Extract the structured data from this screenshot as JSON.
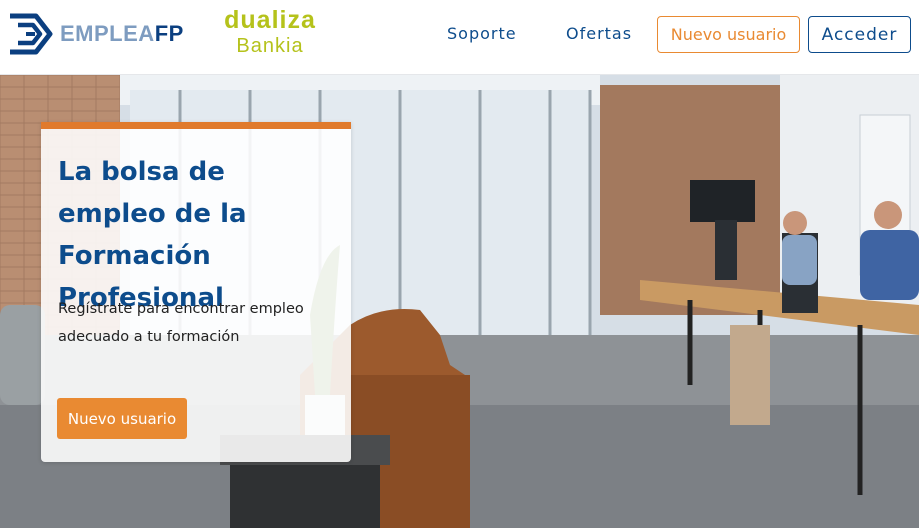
{
  "header": {
    "logo_emplea": {
      "part1": "EMPLEA",
      "part2": "FP"
    },
    "logo_dualiza": {
      "line1": "dualiza",
      "line2": "Bankia"
    },
    "nav": {
      "soporte": "Soporte",
      "ofertas": "Ofertas"
    },
    "buttons": {
      "nuevo_usuario": "Nuevo usuario",
      "acceder": "Acceder"
    }
  },
  "hero": {
    "title": "La bolsa de empleo de la Formación Profesional",
    "subtitle": "Regístrate para encontrar empleo adecuado a tu formación",
    "cta": "Nuevo usuario",
    "image_icon": "office-photo"
  },
  "colors": {
    "brand_blue": "#0d4c8c",
    "accent_orange": "#e98a32",
    "dualiza_green": "#b5c21b"
  }
}
